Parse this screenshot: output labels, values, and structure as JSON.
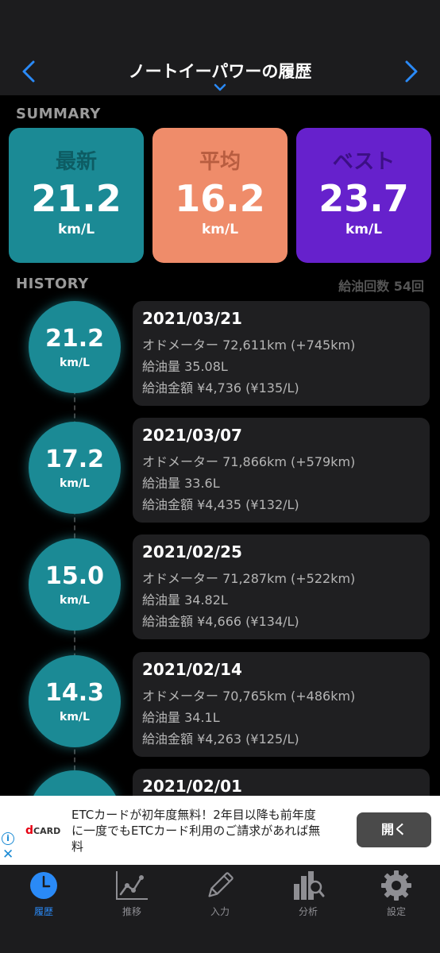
{
  "header": {
    "title": "ノートイーパワーの履歴",
    "icons": {
      "prev": "chevron-left-icon",
      "next": "chevron-right-icon",
      "menu": "chevron-down-icon"
    },
    "accent_color": "#2a8af7"
  },
  "summary": {
    "label": "SUMMARY",
    "cards": [
      {
        "label": "最新",
        "value": "21.2",
        "unit": "km/L",
        "bg": "#1b8a95",
        "label_color": "#0d5c63"
      },
      {
        "label": "平均",
        "value": "16.2",
        "unit": "km/L",
        "bg": "#ef8c6a",
        "label_color": "#b85d40"
      },
      {
        "label": "ベスト",
        "value": "23.7",
        "unit": "km/L",
        "bg": "#6621cc",
        "label_color": "#3c0f85"
      }
    ]
  },
  "history": {
    "label": "HISTORY",
    "count": "給油回数 54回",
    "entries": [
      {
        "efficiency": "21.2",
        "unit": "km/L",
        "date": "2021/03/21",
        "odometer": "オドメーター 72,611km (+745km)",
        "fuel": "給油量 35.08L",
        "cost": "給油金額 ¥4,736 (¥135/L)"
      },
      {
        "efficiency": "17.2",
        "unit": "km/L",
        "date": "2021/03/07",
        "odometer": "オドメーター 71,866km (+579km)",
        "fuel": "給油量 33.6L",
        "cost": "給油金額 ¥4,435 (¥132/L)"
      },
      {
        "efficiency": "15.0",
        "unit": "km/L",
        "date": "2021/02/25",
        "odometer": "オドメーター 71,287km (+522km)",
        "fuel": "給油量 34.82L",
        "cost": "給油金額 ¥4,666 (¥134/L)"
      },
      {
        "efficiency": "14.3",
        "unit": "km/L",
        "date": "2021/02/14",
        "odometer": "オドメーター 70,765km (+486km)",
        "fuel": "給油量 34.1L",
        "cost": "給油金額 ¥4,263 (¥125/L)"
      },
      {
        "date": "2021/02/01"
      }
    ]
  },
  "ad": {
    "brand_d": "d",
    "brand": "CARD",
    "text": "ETCカードが初年度無料！2年目以降も前年度に一度でもETCカード利用のご請求があれば無料",
    "button": "開く",
    "info_icon": "info-icon",
    "close_icon": "close-icon",
    "info_glyph": "i",
    "close_glyph": "✕"
  },
  "tabbar": {
    "tabs": [
      {
        "label": "履歴",
        "icon": "clock-icon",
        "active": true
      },
      {
        "label": "推移",
        "icon": "line-chart-icon",
        "active": false
      },
      {
        "label": "入力",
        "icon": "pencil-icon",
        "active": false
      },
      {
        "label": "分析",
        "icon": "bar-chart-search-icon",
        "active": false
      },
      {
        "label": "設定",
        "icon": "gear-icon",
        "active": false
      }
    ]
  }
}
